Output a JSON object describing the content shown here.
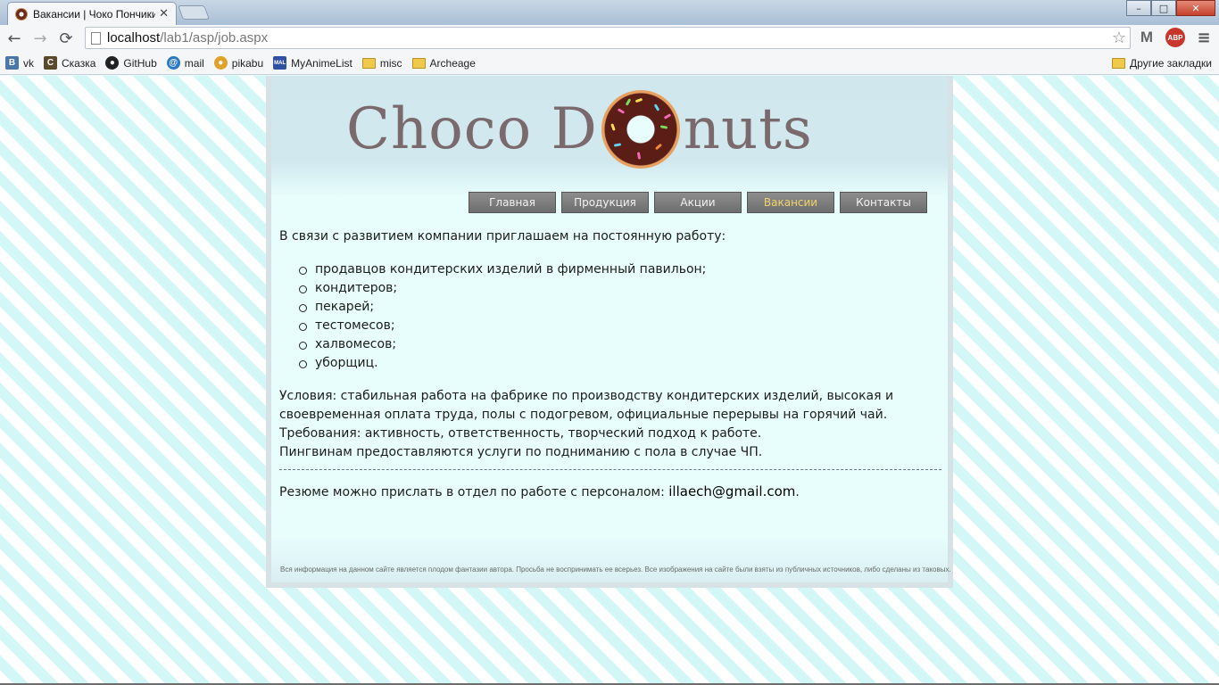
{
  "browser": {
    "tab_title": "Вакансии | Чоко Пончики",
    "tab_close": "✕",
    "url_host": "localhost",
    "url_path": "/lab1/asp/job.aspx",
    "back": "←",
    "forward": "→",
    "reload": "⟳",
    "star": "☆",
    "menu": "≡",
    "abp": "ABP",
    "gmail": "M",
    "win_min": "–",
    "win_max": "□",
    "win_close": "✕"
  },
  "bookmarks": {
    "items": [
      {
        "label": "vk",
        "icon": "В"
      },
      {
        "label": "Сказка",
        "icon": "С"
      },
      {
        "label": "GitHub",
        "icon": "●"
      },
      {
        "label": "mail",
        "icon": "@"
      },
      {
        "label": "pikabu",
        "icon": "●"
      },
      {
        "label": "MyAnimeList",
        "icon": "MAL"
      },
      {
        "label": "misc",
        "icon": ""
      },
      {
        "label": "Archeage",
        "icon": ""
      }
    ],
    "other": "Другие закладки"
  },
  "site": {
    "logo_left": "Choco D",
    "logo_right": "nuts",
    "nav": [
      {
        "label": "Главная"
      },
      {
        "label": "Продукция"
      },
      {
        "label": "Акции"
      },
      {
        "label": "Вакансии"
      },
      {
        "label": "Контакты"
      }
    ],
    "intro": "В связи с развитием компании приглашаем на постоянную работу:",
    "vacancies": [
      "продавцов кондитерских изделий в фирменный павильон;",
      "кондитеров;",
      "пекарей;",
      "тестомесов;",
      "халвомесов;",
      "уборщиц."
    ],
    "conditions_line1": "Условия: стабильная работа на фабрике по производству кондитерских изделий, высокая и",
    "conditions_line2": "своевременная оплата труда, полы с подогревом, официальные перерывы на горячий чай.",
    "requirements": "Требования: активность, ответственность, творческий подход к работе.",
    "penguins": "Пингвинам предоставляются услуги по подниманию с пола в случае ЧП.",
    "resume_text": "Резюме можно прислать в отдел по работе с персоналом: ",
    "email": "illaech@gmail.com",
    "resume_end": ".",
    "footer": "Вся информация на данном сайте является плодом фантазии автора. Просьба не воспринимать ее всерьез. Все изображения на сайте были взяты из публичных источников, либо сделаны из таковых."
  },
  "colors": {
    "nav_active": "#f2d36a",
    "nav_bg": "#7d7d7d",
    "logo": "#7b6a6d"
  }
}
